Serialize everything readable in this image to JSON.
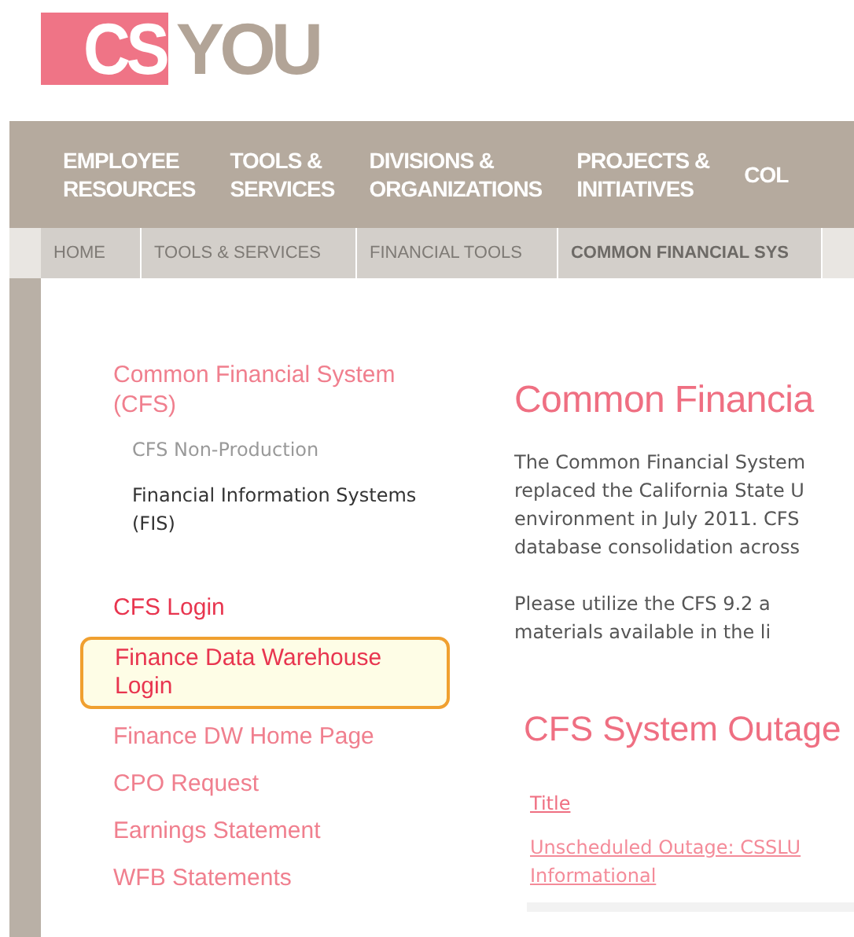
{
  "logo": {
    "highlight": "CS",
    "rest": "YOU"
  },
  "nav": [
    {
      "line1": "EMPLOYEE",
      "line2": "RESOURCES"
    },
    {
      "line1": "TOOLS &",
      "line2": "SERVICES"
    },
    {
      "line1": "DIVISIONS &",
      "line2": "ORGANIZATIONS"
    },
    {
      "line1": "PROJECTS &",
      "line2": "INITIATIVES"
    },
    {
      "line1": "COL"
    }
  ],
  "breadcrumb": [
    {
      "label": "HOME",
      "current": false
    },
    {
      "label": "TOOLS & SERVICES",
      "current": false
    },
    {
      "label": "FINANCIAL TOOLS",
      "current": false
    },
    {
      "label": "COMMON FINANCIAL SYS",
      "current": true
    }
  ],
  "sidebar": {
    "section": "Common Financial System (CFS)",
    "subitems": [
      {
        "label": "CFS Non-Production",
        "current": false
      },
      {
        "label": "Financial Information Systems (FIS)",
        "current": true
      }
    ],
    "links": [
      {
        "label": "CFS Login",
        "color": "#e8354f",
        "selected": false
      },
      {
        "label": "Finance Data Warehouse Login",
        "color": "#e8354f",
        "selected": true
      },
      {
        "label": "Finance DW Home Page",
        "color": "#f07f8e",
        "selected": false
      },
      {
        "label": "CPO Request",
        "color": "#f07f8e",
        "selected": false
      },
      {
        "label": "Earnings Statement",
        "color": "#f07f8e",
        "selected": false
      },
      {
        "label": "WFB Statements",
        "color": "#f07f8e",
        "selected": false
      }
    ]
  },
  "main": {
    "heading": "Common Financia",
    "paragraphs": [
      [
        "The Common Financial System",
        "replaced the California State U",
        "environment in July 2011. CFS",
        "database consolidation across"
      ],
      [
        "Please utilize the CFS 9.2 a",
        "materials available in the li"
      ]
    ],
    "outages": {
      "heading": "CFS System Outage",
      "column": "Title",
      "rows": [
        {
          "title": "Unscheduled Outage: CSSLU",
          "type": "Informational"
        }
      ]
    }
  }
}
